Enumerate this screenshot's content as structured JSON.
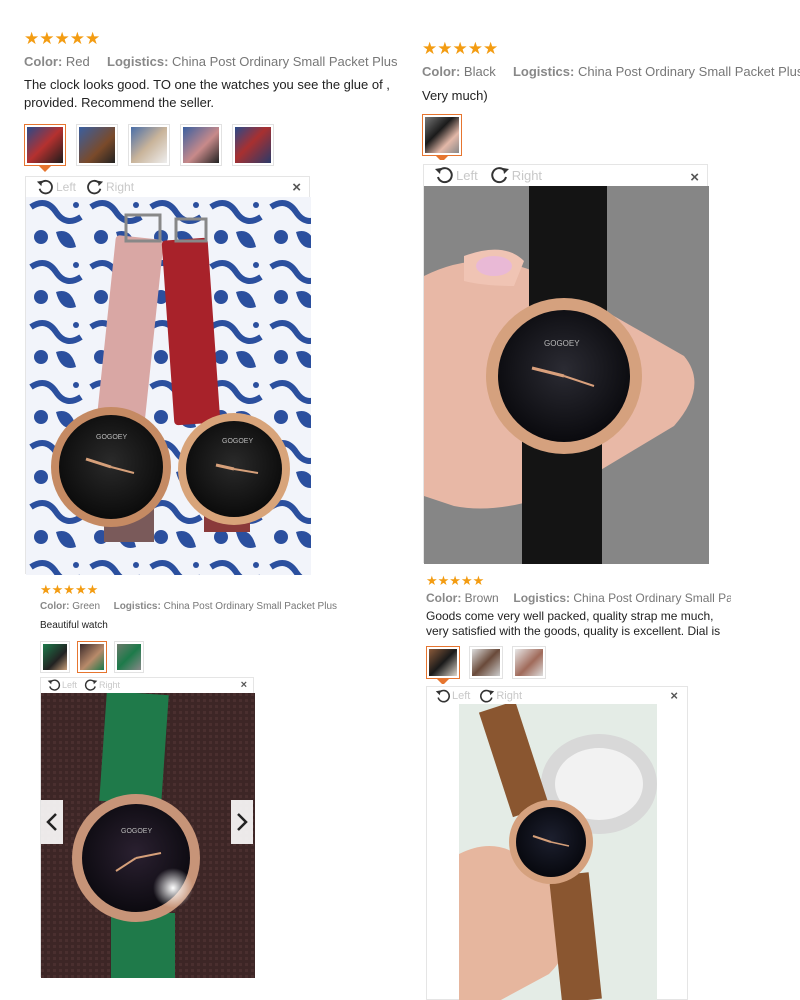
{
  "reviews": [
    {
      "stars": "★★★★★",
      "color_label": "Color:",
      "color_value": "Red",
      "logistics_label": "Logistics:",
      "logistics_value": "China Post Ordinary Small Packet Plus",
      "text": "The clock looks good. TO one the watches you see the glue of , provided. Recommend the seller.",
      "viewer": {
        "left_label": "Left",
        "right_label": "Right",
        "close": "×"
      }
    },
    {
      "stars": "★★★★★",
      "color_label": "Color:",
      "color_value": "Black",
      "logistics_label": "Logistics:",
      "logistics_value": "China Post Ordinary Small Packet Plus",
      "text": "Very much)",
      "viewer": {
        "left_label": "Left",
        "right_label": "Right",
        "close": "×"
      }
    },
    {
      "stars": "★★★★★",
      "color_label": "Color:",
      "color_value": "Green",
      "logistics_label": "Logistics:",
      "logistics_value": "China Post Ordinary Small Packet Plus",
      "text": "Beautiful watch",
      "viewer": {
        "left_label": "Left",
        "right_label": "Right",
        "close": "×"
      }
    },
    {
      "stars": "★★★★★",
      "color_label": "Color:",
      "color_value": "Brown",
      "logistics_label": "Logistics:",
      "logistics_value": "China Post Ordinary Small Packet Plus",
      "text": "Goods come very well packed, quality strap me much, very satisfied with the goods, quality is excellent. Dial is",
      "viewer": {
        "left_label": "Left",
        "right_label": "Right",
        "close": "×"
      }
    }
  ],
  "watch_brand": "GOGOEY",
  "icons": {
    "rotate_left": "rotate-left-icon",
    "rotate_right": "rotate-right-icon",
    "prev": "chevron-left-icon",
    "next": "chevron-right-icon"
  },
  "colors": {
    "star": "#f39c12",
    "active_border": "#e6752f"
  }
}
